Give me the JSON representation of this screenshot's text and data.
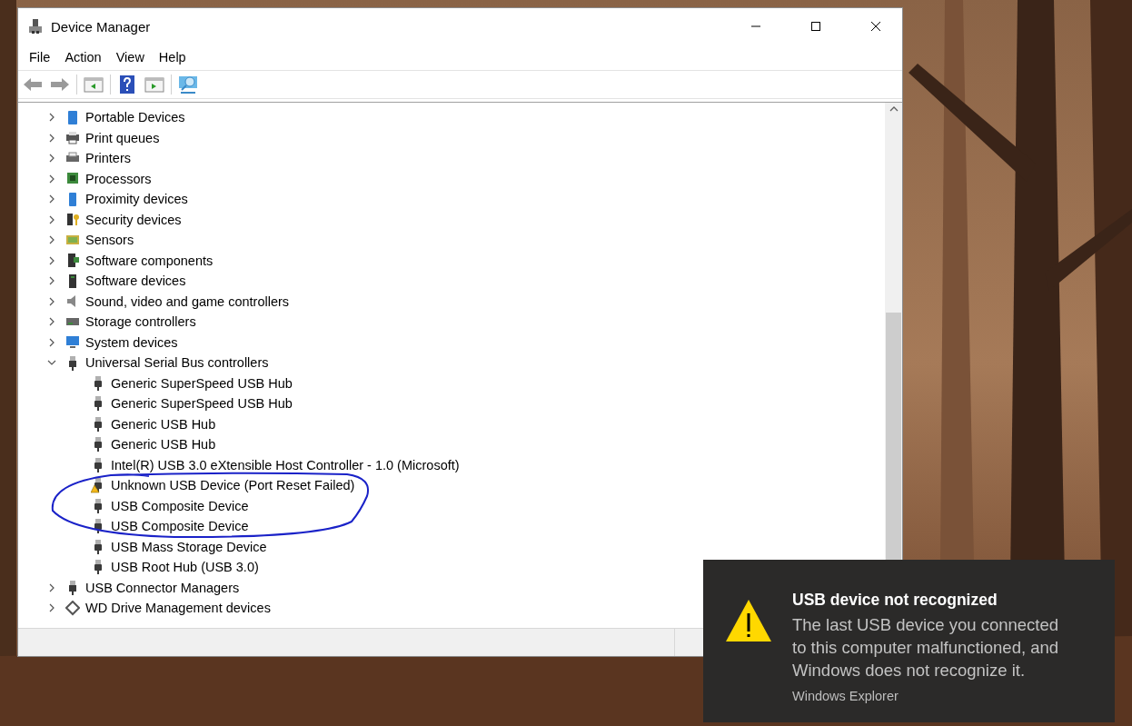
{
  "window": {
    "title": "Device Manager"
  },
  "menu": [
    "File",
    "Action",
    "View",
    "Help"
  ],
  "tree": [
    {
      "label": "Portable Devices",
      "expanded": false
    },
    {
      "label": "Print queues",
      "expanded": false
    },
    {
      "label": "Printers",
      "expanded": false
    },
    {
      "label": "Processors",
      "expanded": false
    },
    {
      "label": "Proximity devices",
      "expanded": false
    },
    {
      "label": "Security devices",
      "expanded": false
    },
    {
      "label": "Sensors",
      "expanded": false
    },
    {
      "label": "Software components",
      "expanded": false
    },
    {
      "label": "Software devices",
      "expanded": false
    },
    {
      "label": "Sound, video and game controllers",
      "expanded": false
    },
    {
      "label": "Storage controllers",
      "expanded": false
    },
    {
      "label": "System devices",
      "expanded": false
    },
    {
      "label": "Universal Serial Bus controllers",
      "expanded": true,
      "children": [
        {
          "label": "Generic SuperSpeed USB Hub",
          "warning": false
        },
        {
          "label": "Generic SuperSpeed USB Hub",
          "warning": false
        },
        {
          "label": "Generic USB Hub",
          "warning": false
        },
        {
          "label": "Generic USB Hub",
          "warning": false
        },
        {
          "label": "Intel(R) USB 3.0 eXtensible Host Controller - 1.0 (Microsoft)",
          "warning": false
        },
        {
          "label": "Unknown USB Device (Port Reset Failed)",
          "warning": true
        },
        {
          "label": "USB Composite Device",
          "warning": false
        },
        {
          "label": "USB Composite Device",
          "warning": false
        },
        {
          "label": "USB Mass Storage Device",
          "warning": false
        },
        {
          "label": "USB Root Hub (USB 3.0)",
          "warning": false
        }
      ]
    },
    {
      "label": "USB Connector Managers",
      "expanded": false
    },
    {
      "label": "WD Drive Management devices",
      "expanded": false
    }
  ],
  "notification": {
    "title": "USB device not recognized",
    "message": "The last USB device you connected to this computer malfunctioned, and Windows does not recognize it.",
    "source": "Windows Explorer"
  }
}
